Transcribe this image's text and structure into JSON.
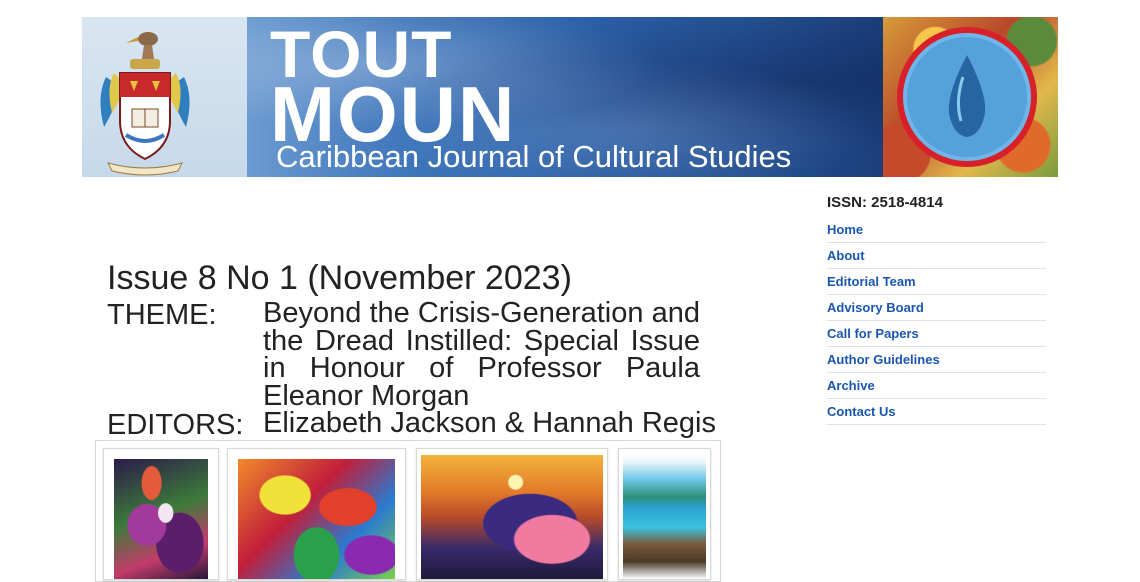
{
  "banner": {
    "title_line1": "TOUT",
    "title_line2": "MOUN",
    "subtitle": "Caribbean Journal of Cultural Studies"
  },
  "issue": {
    "title": "Issue 8 No 1 (November 2023)",
    "theme_label": "THEME:",
    "theme_value": "Beyond the Crisis-Generation and the Dread Instilled: Special Issue in Honour of Professor Paula Eleanor Morgan",
    "editors_label": "EDITORS:",
    "editors_value": "Elizabeth Jackson & Hannah Regis"
  },
  "sidebar": {
    "issn": "ISSN: 2518-4814",
    "nav": [
      {
        "label": "Home"
      },
      {
        "label": "About"
      },
      {
        "label": "Editorial Team"
      },
      {
        "label": "Advisory Board"
      },
      {
        "label": "Call for Papers"
      },
      {
        "label": "Author Guidelines"
      },
      {
        "label": "Archive"
      },
      {
        "label": "Contact Us"
      }
    ]
  },
  "colors": {
    "link": "#1a56b0",
    "text": "#222222"
  }
}
